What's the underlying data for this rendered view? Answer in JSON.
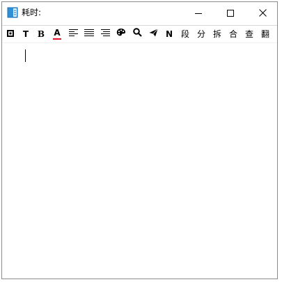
{
  "window": {
    "title": "耗时:",
    "app_icon": "notepad-app-icon",
    "controls": {
      "minimize_icon": "minimize-icon",
      "maximize_icon": "maximize-icon",
      "close_icon": "close-icon"
    }
  },
  "toolbar": {
    "items": [
      {
        "name": "box-button",
        "icon": "square-outline-icon"
      },
      {
        "name": "text-button",
        "label": "T"
      },
      {
        "name": "bold-button",
        "label": "B"
      },
      {
        "name": "font-color-button",
        "label": "A",
        "underline_color": "#e81123"
      },
      {
        "name": "align-left-button",
        "icon": "align-left-icon"
      },
      {
        "name": "align-center-button",
        "icon": "align-justify-icon"
      },
      {
        "name": "align-right-button",
        "icon": "align-right-icon"
      },
      {
        "name": "color-palette-button",
        "icon": "palette-icon"
      },
      {
        "name": "search-button",
        "icon": "search-icon"
      },
      {
        "name": "send-button",
        "icon": "send-icon"
      },
      {
        "name": "n-button",
        "label": "N"
      },
      {
        "name": "segment-button",
        "label": "段"
      },
      {
        "name": "divide-button",
        "label": "分"
      },
      {
        "name": "split-button",
        "label": "拆"
      },
      {
        "name": "merge-button",
        "label": "合"
      },
      {
        "name": "lookup-button",
        "label": "查"
      },
      {
        "name": "translate-button",
        "label": "翻"
      }
    ]
  },
  "editor": {
    "content": ""
  },
  "colors": {
    "accent_red": "#e81123",
    "border": "#8a8a8a",
    "app_icon_blue": "#2f8fd8"
  }
}
